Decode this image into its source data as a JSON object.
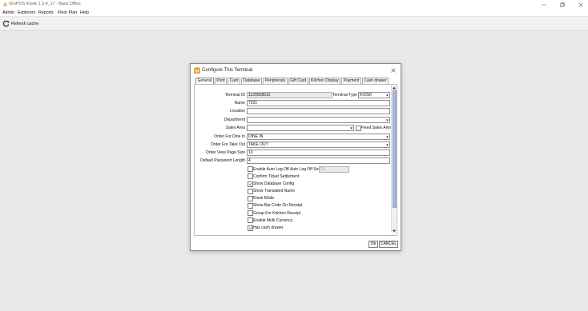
{
  "window": {
    "title": "OroPOS Kiosk 1.3.4_17 - Back Office"
  },
  "menu": [
    "Admin",
    "Explorers",
    "Reports",
    "Floor Plan",
    "Help"
  ],
  "toolbar": {
    "refresh_label": "Refresh cache"
  },
  "dialog": {
    "title": "Configure This Terminal",
    "tabs": [
      "General",
      "Print",
      "Card",
      "Database",
      "Peripherals",
      "Gift Card",
      "Kitchen Display",
      "Payment",
      "Cash drawer"
    ],
    "active_tab": "General",
    "fields": {
      "terminal_id": {
        "label": "Terminal ID",
        "value": "1120558012"
      },
      "terminal_type": {
        "label": "Terminal Type",
        "value": "KIOSK"
      },
      "name": {
        "label": "Name",
        "value": "7231"
      },
      "location": {
        "label": "Location",
        "value": ""
      },
      "department": {
        "label": "Department",
        "value": ""
      },
      "sales_area": {
        "label": "Sales Area",
        "value": ""
      },
      "fixed_sales_area": {
        "label": "Fixed Sales Area",
        "checked": false
      },
      "order_dine_in": {
        "label": "Order For Dine In",
        "value": "DINE IN"
      },
      "order_take_out": {
        "label": "Order For Take Out",
        "value": "TAKE OUT"
      },
      "order_view_page_size": {
        "label": "Order View Page Size",
        "value": "10"
      },
      "default_password_length": {
        "label": "Default Password Length",
        "value": "4"
      },
      "auto_log_off_sec": {
        "label": "Auto Log Off Sec",
        "value": "10"
      }
    },
    "options": [
      {
        "label": "Enable Auto Log Off",
        "checked": false
      },
      {
        "label": "Confirm Ticket Settlement",
        "checked": false
      },
      {
        "label": "Show Database Config",
        "checked": true
      },
      {
        "label": "Show Translated Name",
        "checked": false
      },
      {
        "label": "Kiosk Mode",
        "checked": false
      },
      {
        "label": "Show Bar Code On Receipt",
        "checked": false
      },
      {
        "label": "Group For Kitchen Receipt",
        "checked": false
      },
      {
        "label": "Enable Multi Currency",
        "checked": false
      },
      {
        "label": "Has cash drawer",
        "checked": true
      }
    ],
    "buttons": {
      "ok": "Ok",
      "cancel": "CANCEL"
    }
  },
  "colors": {
    "background": "#e9e9eb",
    "dialog_bg": "#ffffff",
    "scroll_thumb": "#a8bad2",
    "app_icon": "#e8902a"
  },
  "icons": {
    "app": "oropos-logo-icon",
    "refresh": "refresh-icon",
    "close": "close-icon",
    "dialog": "terminal-config-icon"
  }
}
